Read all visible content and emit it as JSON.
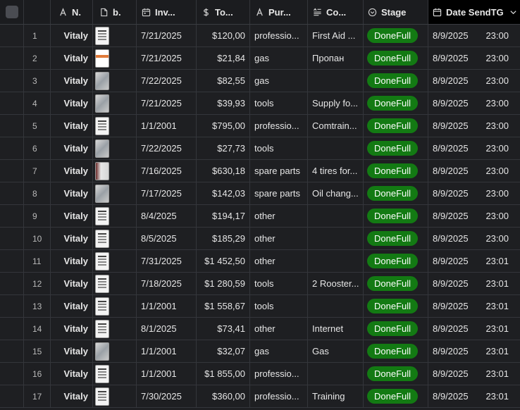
{
  "header": {
    "name": "N.",
    "b": "b.",
    "invoice": "Inv...",
    "total": "To...",
    "purpose": "Pur...",
    "comment": "Co...",
    "stage": "Stage",
    "date_send": "Date SendTG"
  },
  "colors": {
    "stage_pill": "#137a13",
    "background": "#1e1f22",
    "active_header": "#000000"
  },
  "rows": [
    {
      "num": "1",
      "name": "Vitaly",
      "thumb": "lines",
      "inv": "7/21/2025",
      "total": "$120,00",
      "purpose": "professio...",
      "comment": "First Aid ...",
      "stage": "DoneFull",
      "date": "8/9/2025",
      "time": "23:00"
    },
    {
      "num": "2",
      "name": "Vitaly",
      "thumb": "orange",
      "inv": "7/21/2025",
      "total": "$21,84",
      "purpose": "gas",
      "comment": "Пропан",
      "stage": "DoneFull",
      "date": "8/9/2025",
      "time": "23:00"
    },
    {
      "num": "3",
      "name": "Vitaly",
      "thumb": "photo",
      "inv": "7/22/2025",
      "total": "$82,55",
      "purpose": "gas",
      "comment": "",
      "stage": "DoneFull",
      "date": "8/9/2025",
      "time": "23:00"
    },
    {
      "num": "4",
      "name": "Vitaly",
      "thumb": "photo",
      "inv": "7/21/2025",
      "total": "$39,93",
      "purpose": "tools",
      "comment": "Supply fo...",
      "stage": "DoneFull",
      "date": "8/9/2025",
      "time": "23:00"
    },
    {
      "num": "5",
      "name": "Vitaly",
      "thumb": "plain",
      "inv": "1/1/2001",
      "total": "$795,00",
      "purpose": "professio...",
      "comment": "Comtrain...",
      "stage": "DoneFull",
      "date": "8/9/2025",
      "time": "23:00"
    },
    {
      "num": "6",
      "name": "Vitaly",
      "thumb": "photo",
      "inv": "7/22/2025",
      "total": "$27,73",
      "purpose": "tools",
      "comment": "",
      "stage": "DoneFull",
      "date": "8/9/2025",
      "time": "23:00"
    },
    {
      "num": "7",
      "name": "Vitaly",
      "thumb": "red",
      "inv": "7/16/2025",
      "total": "$630,18",
      "purpose": "spare parts",
      "comment": "4 tires for...",
      "stage": "DoneFull",
      "date": "8/9/2025",
      "time": "23:00"
    },
    {
      "num": "8",
      "name": "Vitaly",
      "thumb": "photo",
      "inv": "7/17/2025",
      "total": "$142,03",
      "purpose": "spare parts",
      "comment": "Oil chang...",
      "stage": "DoneFull",
      "date": "8/9/2025",
      "time": "23:00"
    },
    {
      "num": "9",
      "name": "Vitaly",
      "thumb": "lines",
      "inv": "8/4/2025",
      "total": "$194,17",
      "purpose": "other",
      "comment": "",
      "stage": "DoneFull",
      "date": "8/9/2025",
      "time": "23:00"
    },
    {
      "num": "10",
      "name": "Vitaly",
      "thumb": "lines",
      "inv": "8/5/2025",
      "total": "$185,29",
      "purpose": "other",
      "comment": "",
      "stage": "DoneFull",
      "date": "8/9/2025",
      "time": "23:00"
    },
    {
      "num": "11",
      "name": "Vitaly",
      "thumb": "lines",
      "inv": "7/31/2025",
      "total": "$1 452,50",
      "purpose": "other",
      "comment": "",
      "stage": "DoneFull",
      "date": "8/9/2025",
      "time": "23:01"
    },
    {
      "num": "12",
      "name": "Vitaly",
      "thumb": "plain",
      "inv": "7/18/2025",
      "total": "$1 280,59",
      "purpose": "tools",
      "comment": "2 Rooster...",
      "stage": "DoneFull",
      "date": "8/9/2025",
      "time": "23:01"
    },
    {
      "num": "13",
      "name": "Vitaly",
      "thumb": "plain",
      "inv": "1/1/2001",
      "total": "$1 558,67",
      "purpose": "tools",
      "comment": "",
      "stage": "DoneFull",
      "date": "8/9/2025",
      "time": "23:01"
    },
    {
      "num": "14",
      "name": "Vitaly",
      "thumb": "plain",
      "inv": "8/1/2025",
      "total": "$73,41",
      "purpose": "other",
      "comment": "Internet",
      "stage": "DoneFull",
      "date": "8/9/2025",
      "time": "23:01"
    },
    {
      "num": "15",
      "name": "Vitaly",
      "thumb": "photo",
      "inv": "1/1/2001",
      "total": "$32,07",
      "purpose": "gas",
      "comment": "Gas",
      "stage": "DoneFull",
      "date": "8/9/2025",
      "time": "23:01"
    },
    {
      "num": "16",
      "name": "Vitaly",
      "thumb": "plain",
      "inv": "1/1/2001",
      "total": "$1 855,00",
      "purpose": "professio...",
      "comment": "",
      "stage": "DoneFull",
      "date": "8/9/2025",
      "time": "23:01"
    },
    {
      "num": "17",
      "name": "Vitaly",
      "thumb": "plain",
      "inv": "7/30/2025",
      "total": "$360,00",
      "purpose": "professio...",
      "comment": "Training",
      "stage": "DoneFull",
      "date": "8/9/2025",
      "time": "23:01"
    }
  ]
}
